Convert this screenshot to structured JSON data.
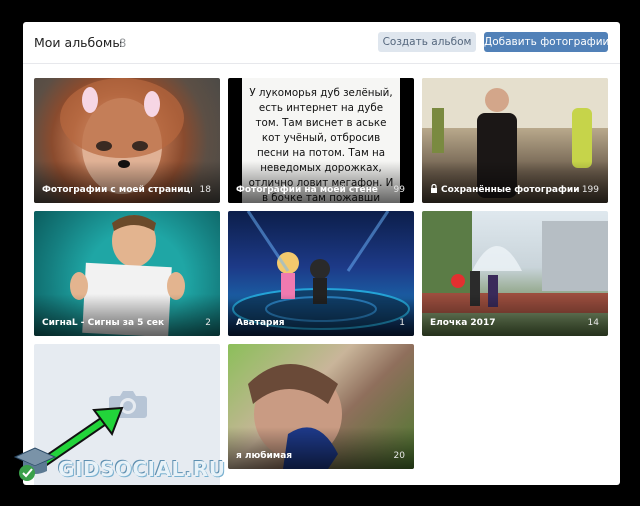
{
  "header": {
    "title": "Мои альбомы",
    "count": "8",
    "create_album_label": "Создать альбом",
    "add_photos_label": "Добавить фотографии"
  },
  "albums": [
    {
      "label": "Фотографии с моей страницы",
      "count": "18"
    },
    {
      "label": "Фотографии на моей стене",
      "count": "99",
      "poem": "У лукоморья дуб зелёный, есть интернет на дубе том. Там виснет в аське кот учёный, отбросив песни на потом. Там на неведомых дорожках, отлично ловит мегафон. И в бочке там пожавши ножки, по морю мчит там царь Гвидон. Царевна sms всем пишет, а"
    },
    {
      "label": "Сохранённые фотографии",
      "count": "199",
      "icon": "lock-icon"
    },
    {
      "label": "СигнaL - Сигны за 5 сек",
      "count": "2"
    },
    {
      "label": "Аватария",
      "count": "1"
    },
    {
      "label": "Ёлочка 2017",
      "count": "14"
    },
    {
      "label": "",
      "count": "",
      "icon": "camera-icon"
    },
    {
      "label": "я любимая",
      "count": "20"
    }
  ],
  "watermark": {
    "text": "GIDSOCIAL.RU"
  },
  "colors": {
    "accent": "#5181b8",
    "secondary_button": "#dfe6ee",
    "arrow": "#22d43a"
  }
}
